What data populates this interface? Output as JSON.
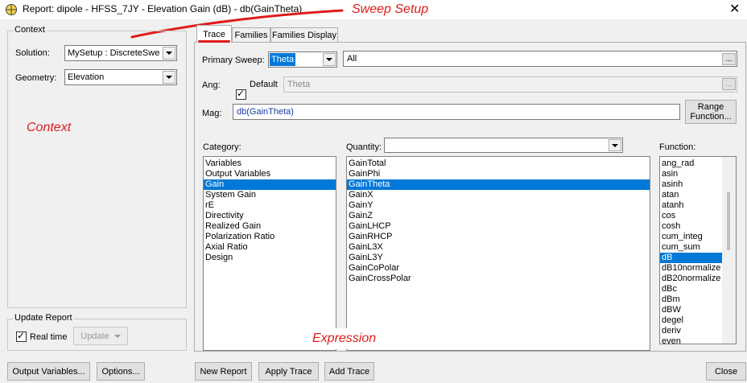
{
  "window": {
    "title": "Report: dipole - HFSS_7JY - Elevation Gain (dB) - db(GainTheta)",
    "icon": "crosshair-circle-icon",
    "close_glyph": "✕"
  },
  "annotations": {
    "sweep_setup": "Sweep Setup",
    "context": "Context",
    "expression": "Expression",
    "color": "#e01b1b"
  },
  "context": {
    "group_label": "Context",
    "solution_label": "Solution:",
    "solution_value": "MySetup : DiscreteSweep",
    "geometry_label": "Geometry:",
    "geometry_value": "Elevation"
  },
  "update_report": {
    "group_label": "Update Report",
    "realtime_label": "Real time",
    "realtime_checked": true,
    "update_button": "Update"
  },
  "tabs": [
    {
      "label": "Trace",
      "active": true
    },
    {
      "label": "Families",
      "active": false
    },
    {
      "label": "Families Display",
      "active": false
    }
  ],
  "trace": {
    "primary_sweep_label": "Primary Sweep:",
    "primary_sweep_value": "Theta",
    "primary_sweep_range": "All",
    "ellipsis": "...",
    "ang_label": "Ang:",
    "default_label": "Default",
    "default_checked": true,
    "ang_value": "Theta",
    "mag_label": "Mag:",
    "mag_value": "db(GainTheta)",
    "range_function_line1": "Range",
    "range_function_line2": "Function..."
  },
  "category": {
    "label": "Category:",
    "items": [
      "Variables",
      "Output Variables",
      "Gain",
      "System Gain",
      "rE",
      "Directivity",
      "Realized Gain",
      "Polarization Ratio",
      "Axial Ratio",
      "Design"
    ],
    "selected": "Gain"
  },
  "quantity": {
    "label": "Quantity:",
    "filter_value": "",
    "items": [
      "GainTotal",
      "GainPhi",
      "GainTheta",
      "GainX",
      "GainY",
      "GainZ",
      "GainLHCP",
      "GainRHCP",
      "GainL3X",
      "GainL3Y",
      "GainCoPolar",
      "GainCrossPolar"
    ],
    "selected": "GainTheta"
  },
  "function": {
    "label": "Function:",
    "items": [
      "ang_rad",
      "asin",
      "asinh",
      "atan",
      "atanh",
      "cos",
      "cosh",
      "cum_integ",
      "cum_sum",
      "dB",
      "dB10normalize",
      "dB20normalize",
      "dBc",
      "dBm",
      "dBW",
      "degel",
      "deriv",
      "even"
    ],
    "selected": "dB"
  },
  "bottom_buttons": {
    "output_variables": "Output Variables...",
    "options": "Options...",
    "new_report": "New Report",
    "apply_trace": "Apply Trace",
    "add_trace": "Add Trace",
    "close": "Close"
  }
}
